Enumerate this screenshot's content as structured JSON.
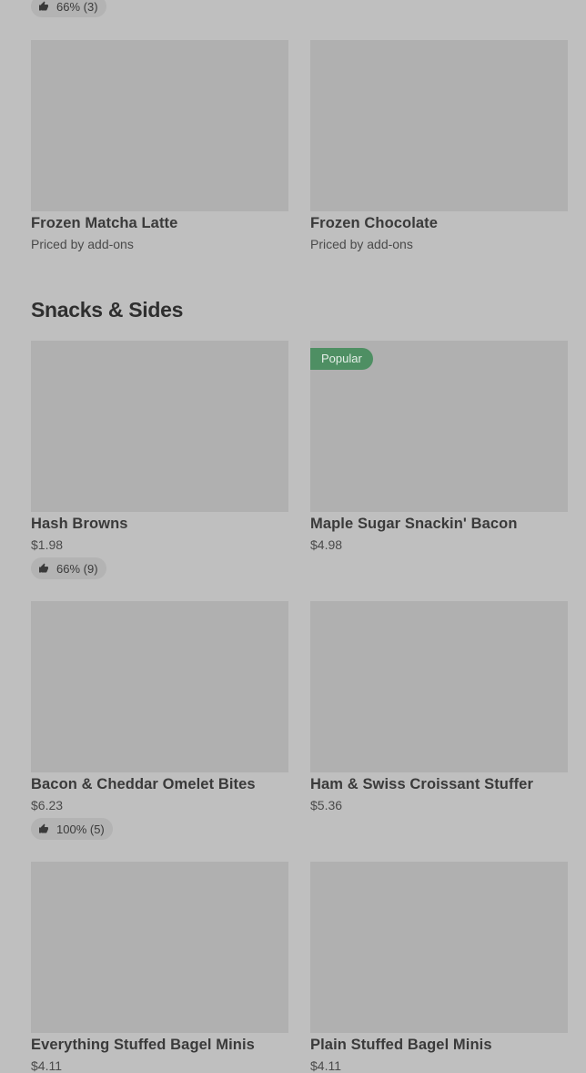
{
  "colors": {
    "background": "#bfbfbf",
    "image_placeholder": "#b0b0b0",
    "popular_badge": "#4e8f63"
  },
  "top_item": {
    "rating": "66% (3)"
  },
  "drinks": [
    {
      "name": "Frozen Matcha Latte",
      "price": "Priced by add-ons"
    },
    {
      "name": "Frozen Chocolate",
      "price": "Priced by add-ons"
    }
  ],
  "snacks_section": {
    "title": "Snacks & Sides",
    "items": [
      {
        "name": "Hash Browns",
        "price": "$1.98",
        "rating": "66% (9)"
      },
      {
        "name": "Maple Sugar Snackin' Bacon",
        "price": "$4.98",
        "badge": "Popular"
      },
      {
        "name": "Bacon & Cheddar Omelet Bites",
        "price": "$6.23",
        "rating": "100% (5)"
      },
      {
        "name": "Ham & Swiss Croissant Stuffer",
        "price": "$5.36"
      },
      {
        "name": "Everything Stuffed Bagel Minis",
        "price": "$4.11"
      },
      {
        "name": "Plain Stuffed Bagel Minis",
        "price": "$4.11"
      }
    ]
  }
}
